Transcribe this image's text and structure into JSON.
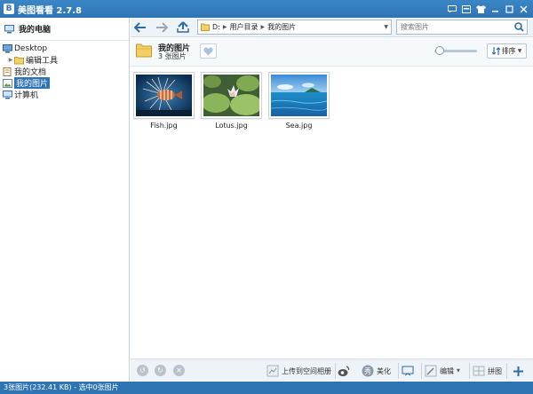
{
  "app": {
    "title": "美图看看 2.7.8",
    "logo_letter": "B"
  },
  "sidebar": {
    "root_label": "我的电脑",
    "tree": [
      {
        "label": "Desktop",
        "icon": "desktop-icon"
      },
      {
        "label": "编辑工具",
        "icon": "folder-icon"
      },
      {
        "label": "我的文档",
        "icon": "documents-icon"
      },
      {
        "label": "我的图片",
        "icon": "pictures-icon",
        "selected": true
      },
      {
        "label": "计算机",
        "icon": "computer-icon"
      }
    ]
  },
  "navbar": {
    "path": [
      "D:",
      "用户目录",
      "我的图片"
    ],
    "search_placeholder": "搜索图片"
  },
  "folder": {
    "name": "我的图片",
    "count": "3 张图片",
    "sort_label": "排序"
  },
  "thumbnails": [
    {
      "filename": "Fish.jpg"
    },
    {
      "filename": "Lotus.jpg"
    },
    {
      "filename": "Sea.jpg"
    }
  ],
  "bottom_toolbar": {
    "upload_label": "上传到空间相册",
    "beautify_label": "美化",
    "edit_label": "编辑",
    "collage_label": "拼图"
  },
  "status": {
    "text": "3张图片(232.41 KB) - 选中0张图片"
  },
  "colors": {
    "accent": "#2f74b3",
    "selection": "#2f74b3"
  }
}
